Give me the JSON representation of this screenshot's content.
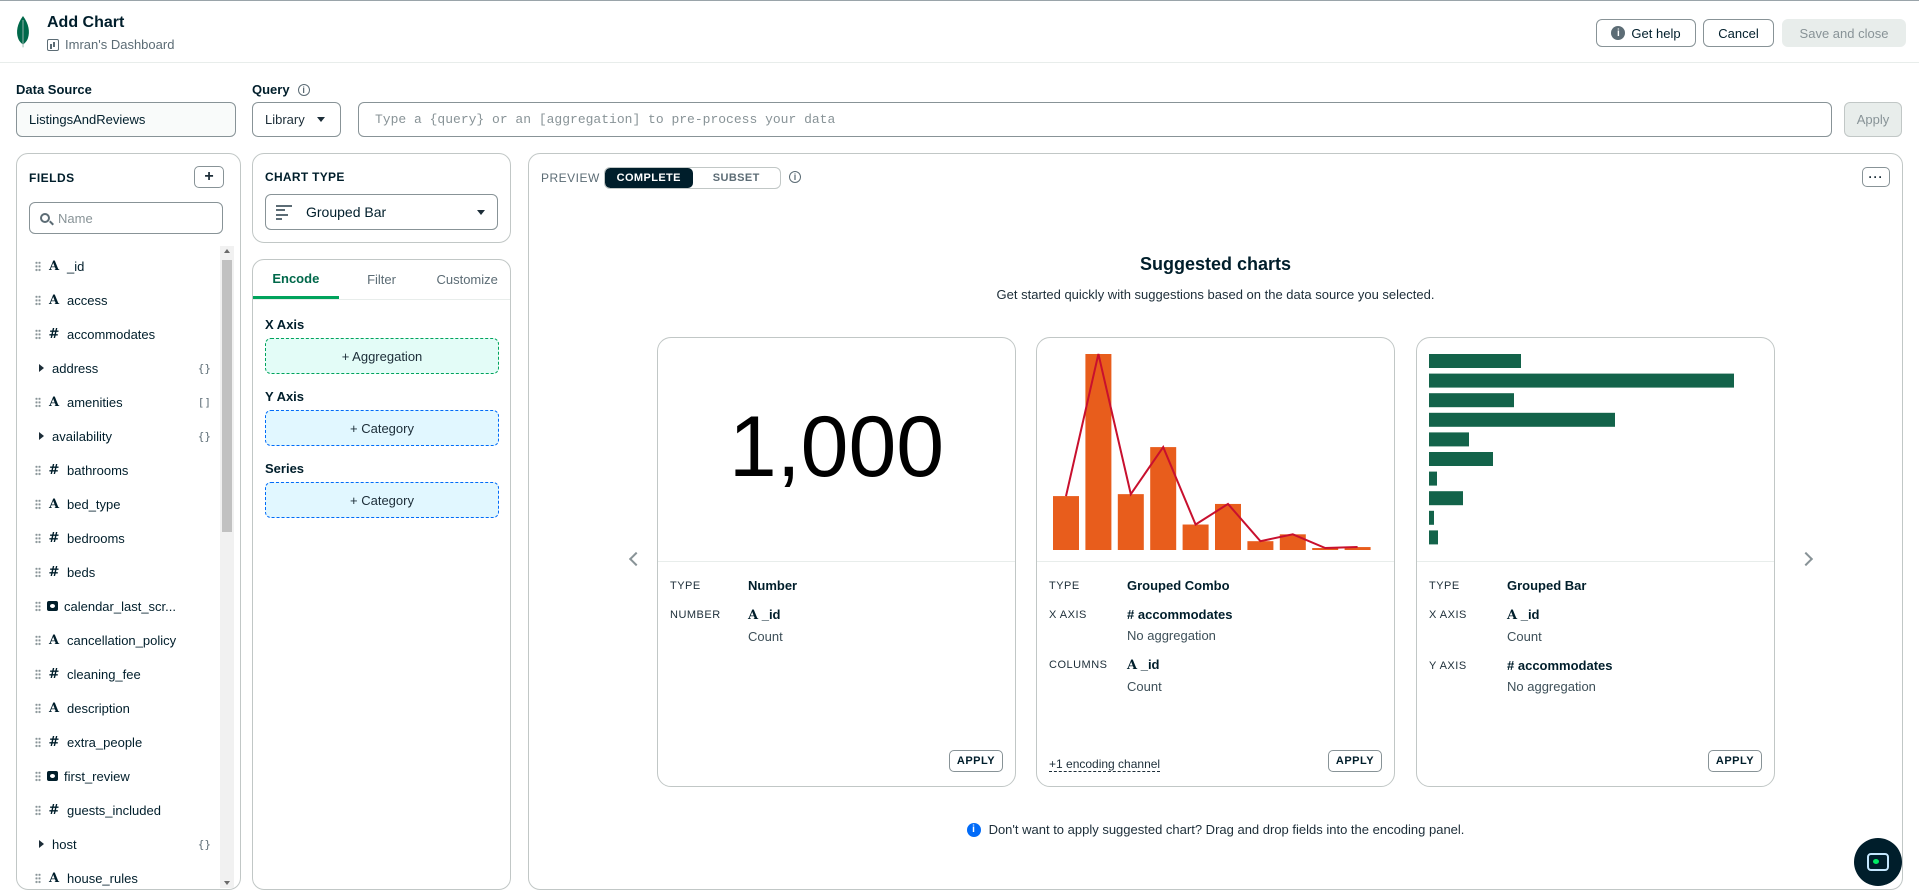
{
  "header": {
    "title": "Add Chart",
    "dashboard": "Imran's Dashboard",
    "help_label": "Get help",
    "cancel_label": "Cancel",
    "save_label": "Save and close"
  },
  "data_source": {
    "label": "Data Source",
    "value": "ListingsAndReviews"
  },
  "query": {
    "label": "Query",
    "mode": "Library",
    "placeholder": "Type a {query} or an [aggregation] to pre-process your data",
    "apply_label": "Apply"
  },
  "fields": {
    "title": "FIELDS",
    "search_placeholder": "Name",
    "items": [
      {
        "name": "_id",
        "type": "A"
      },
      {
        "name": "access",
        "type": "A"
      },
      {
        "name": "accommodates",
        "type": "#"
      },
      {
        "name": "address",
        "type": "object",
        "badge": "{}"
      },
      {
        "name": "amenities",
        "type": "A",
        "badge": "[]"
      },
      {
        "name": "availability",
        "type": "object",
        "badge": "{}"
      },
      {
        "name": "bathrooms",
        "type": "#"
      },
      {
        "name": "bed_type",
        "type": "A"
      },
      {
        "name": "bedrooms",
        "type": "#"
      },
      {
        "name": "beds",
        "type": "#"
      },
      {
        "name": "calendar_last_scr...",
        "type": "date"
      },
      {
        "name": "cancellation_policy",
        "type": "A"
      },
      {
        "name": "cleaning_fee",
        "type": "#"
      },
      {
        "name": "description",
        "type": "A"
      },
      {
        "name": "extra_people",
        "type": "#"
      },
      {
        "name": "first_review",
        "type": "date"
      },
      {
        "name": "guests_included",
        "type": "#"
      },
      {
        "name": "host",
        "type": "object",
        "badge": "{}"
      },
      {
        "name": "house_rules",
        "type": "A"
      }
    ]
  },
  "chart_type": {
    "title": "CHART TYPE",
    "value": "Grouped Bar"
  },
  "encode": {
    "tabs": [
      "Encode",
      "Filter",
      "Customize"
    ],
    "x_axis_label": "X Axis",
    "x_axis_drop": "+ Aggregation",
    "y_axis_label": "Y Axis",
    "y_axis_drop": "+ Category",
    "series_label": "Series",
    "series_drop": "+ Category"
  },
  "preview": {
    "label": "PREVIEW",
    "complete": "COMPLETE",
    "subset": "SUBSET",
    "more": "···",
    "suggested_title": "Suggested charts",
    "suggested_subtitle": "Get started quickly with suggestions based on the data source you selected.",
    "footnote": "Don't want to apply suggested chart? Drag and drop fields into the encoding panel.",
    "apply_label": "APPLY",
    "cards": [
      {
        "number": "1,000",
        "type_key": "TYPE",
        "type": "Number",
        "row1_key": "NUMBER",
        "row1_field": "_id",
        "row1_sub": "Count"
      },
      {
        "type_key": "TYPE",
        "type": "Grouped Combo",
        "row1_key": "X AXIS",
        "row1_field": "accommodates",
        "row1_sub": "No aggregation",
        "row2_key": "COLUMNS",
        "row2_field": "_id",
        "row2_sub": "Count",
        "extra": "+1 encoding channel"
      },
      {
        "type_key": "TYPE",
        "type": "Grouped Bar",
        "row1_key": "X AXIS",
        "row1_field": "_id",
        "row1_sub": "Count",
        "row2_key": "Y AXIS",
        "row2_field": "accommodates",
        "row2_sub": "No aggregation"
      }
    ]
  },
  "colors": {
    "combo_bar": "#e85d1c",
    "combo_line": "#c8102e",
    "hbar": "#13634a",
    "accent": "#00684a"
  },
  "thumb_combo": {
    "bars": [
      55,
      200,
      57,
      105,
      26,
      47,
      9,
      16,
      2,
      3
    ],
    "line": [
      55,
      200,
      57,
      105,
      26,
      47,
      9,
      16,
      2,
      3
    ]
  },
  "thumb_hbar": {
    "bars": [
      92,
      305,
      85,
      186,
      40,
      64,
      8,
      34,
      5,
      9
    ]
  }
}
